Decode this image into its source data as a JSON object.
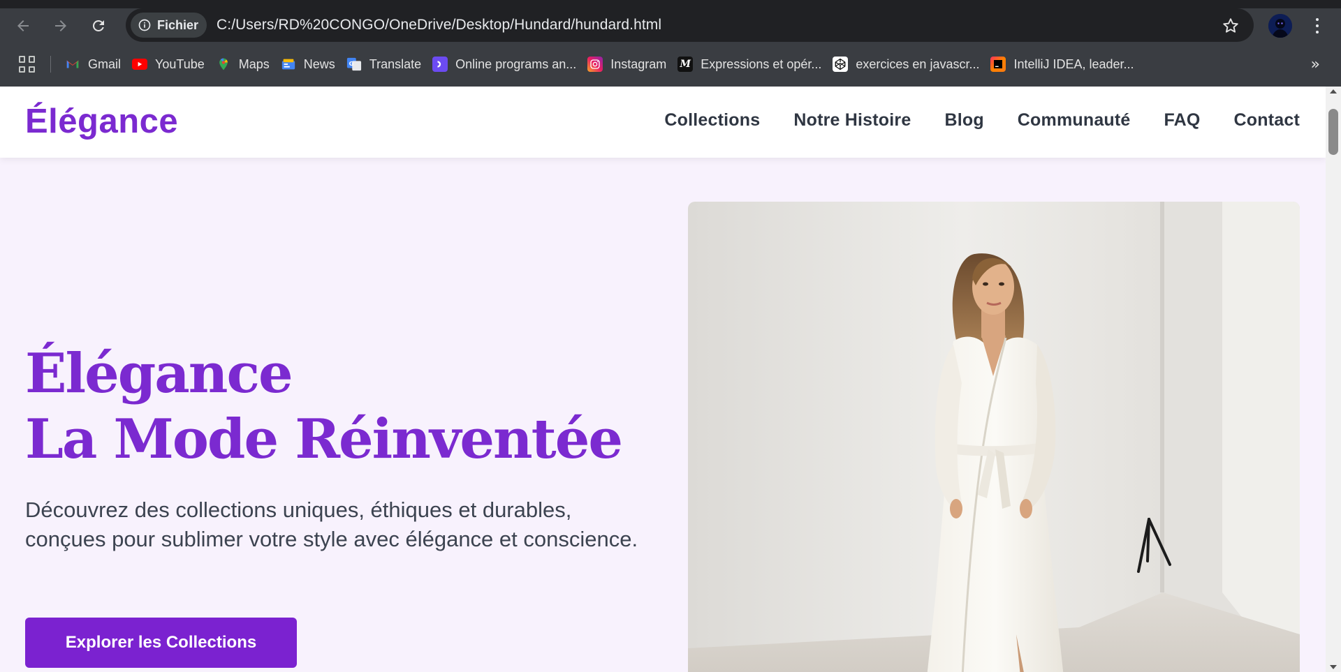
{
  "browser": {
    "site_info_label": "Fichier",
    "url": "C:/Users/RD%20CONGO/OneDrive/Desktop/Hundard/hundard.html",
    "bookmarks": [
      {
        "label": "Gmail",
        "icon": "gmail-icon"
      },
      {
        "label": "YouTube",
        "icon": "youtube-icon"
      },
      {
        "label": "Maps",
        "icon": "maps-icon"
      },
      {
        "label": "News",
        "icon": "news-icon"
      },
      {
        "label": "Translate",
        "icon": "translate-icon"
      },
      {
        "label": "Online programs an...",
        "icon": "online-programs-icon"
      },
      {
        "label": "Instagram",
        "icon": "instagram-icon"
      },
      {
        "label": "Expressions et opér...",
        "icon": "expressions-icon"
      },
      {
        "label": "exercices en  javascr...",
        "icon": "codepen-icon"
      },
      {
        "label": "IntelliJ IDEA, leader...",
        "icon": "intellij-icon"
      }
    ],
    "more_bookmarks": "»"
  },
  "site": {
    "logo": "Élégance",
    "nav": [
      "Collections",
      "Notre Histoire",
      "Blog",
      "Communauté",
      "FAQ",
      "Contact"
    ],
    "hero": {
      "title_line1": "Élégance",
      "title_line2": "La Mode Réinventée",
      "text": "Découvrez des collections uniques, éthiques et durables, conçues pour sublimer votre style avec élégance et conscience.",
      "cta": "Explorer les Collections",
      "image_alt": "Woman in a white wrap dress"
    },
    "colors": {
      "brand": "#7b2ad0",
      "page_bg": "#f8f2fd",
      "nav_text": "#2f3642"
    }
  }
}
